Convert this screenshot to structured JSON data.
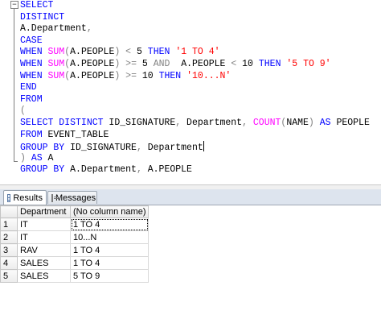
{
  "editor": {
    "lines": [
      [
        {
          "t": "SELECT",
          "c": "kw"
        }
      ],
      [
        {
          "t": "DISTINCT",
          "c": "kw"
        }
      ],
      [
        {
          "t": "A.Department",
          "c": ""
        },
        {
          "t": ",",
          "c": "op"
        }
      ],
      [
        {
          "t": "CASE",
          "c": "kw"
        }
      ],
      [
        {
          "t": "WHEN ",
          "c": "kw"
        },
        {
          "t": "SUM",
          "c": "fn"
        },
        {
          "t": "(",
          "c": "op"
        },
        {
          "t": "A.PEOPLE",
          "c": ""
        },
        {
          "t": ")",
          "c": "op"
        },
        {
          "t": " ",
          "c": ""
        },
        {
          "t": "<",
          "c": "op"
        },
        {
          "t": " 5 ",
          "c": ""
        },
        {
          "t": "THEN ",
          "c": "kw"
        },
        {
          "t": "'1 TO 4'",
          "c": "str"
        }
      ],
      [
        {
          "t": "WHEN ",
          "c": "kw"
        },
        {
          "t": "SUM",
          "c": "fn"
        },
        {
          "t": "(",
          "c": "op"
        },
        {
          "t": "A.PEOPLE",
          "c": ""
        },
        {
          "t": ")",
          "c": "op"
        },
        {
          "t": " ",
          "c": ""
        },
        {
          "t": ">=",
          "c": "op"
        },
        {
          "t": " 5 ",
          "c": ""
        },
        {
          "t": "AND",
          "c": "op"
        },
        {
          "t": "  A.PEOPLE ",
          "c": ""
        },
        {
          "t": "<",
          "c": "op"
        },
        {
          "t": " 10 ",
          "c": ""
        },
        {
          "t": "THEN ",
          "c": "kw"
        },
        {
          "t": "'5 TO 9'",
          "c": "str"
        }
      ],
      [
        {
          "t": "WHEN ",
          "c": "kw"
        },
        {
          "t": "SUM",
          "c": "fn"
        },
        {
          "t": "(",
          "c": "op"
        },
        {
          "t": "A.PEOPLE",
          "c": ""
        },
        {
          "t": ")",
          "c": "op"
        },
        {
          "t": " ",
          "c": ""
        },
        {
          "t": ">=",
          "c": "op"
        },
        {
          "t": " 10 ",
          "c": ""
        },
        {
          "t": "THEN ",
          "c": "kw"
        },
        {
          "t": "'10...N'",
          "c": "str"
        }
      ],
      [
        {
          "t": "END",
          "c": "kw"
        }
      ],
      [
        {
          "t": "FROM",
          "c": "kw"
        }
      ],
      [
        {
          "t": "(",
          "c": "op"
        }
      ],
      [
        {
          "t": "SELECT DISTINCT ",
          "c": "kw"
        },
        {
          "t": "ID_SIGNATURE",
          "c": ""
        },
        {
          "t": ",",
          "c": "op"
        },
        {
          "t": " Department",
          "c": ""
        },
        {
          "t": ",",
          "c": "op"
        },
        {
          "t": " ",
          "c": ""
        },
        {
          "t": "COUNT",
          "c": "fn"
        },
        {
          "t": "(",
          "c": "op"
        },
        {
          "t": "NAME",
          "c": ""
        },
        {
          "t": ")",
          "c": "op"
        },
        {
          "t": " ",
          "c": ""
        },
        {
          "t": "AS",
          "c": "kw"
        },
        {
          "t": " PEOPLE",
          "c": ""
        }
      ],
      [
        {
          "t": "FROM",
          "c": "kw"
        },
        {
          "t": " EVENT_TABLE",
          "c": ""
        }
      ],
      [
        {
          "t": "GROUP BY",
          "c": "kw"
        },
        {
          "t": " ID_SIGNATURE",
          "c": ""
        },
        {
          "t": ",",
          "c": "op"
        },
        {
          "t": " Department",
          "c": ""
        }
      ],
      [
        {
          "t": ")",
          "c": "op"
        },
        {
          "t": " ",
          "c": ""
        },
        {
          "t": "AS",
          "c": "kw"
        },
        {
          "t": " A",
          "c": ""
        }
      ],
      [
        {
          "t": "GROUP BY",
          "c": "kw"
        },
        {
          "t": " A.Department",
          "c": ""
        },
        {
          "t": ",",
          "c": "op"
        },
        {
          "t": " A.PEOPLE",
          "c": ""
        }
      ]
    ],
    "caret_line": 12
  },
  "tabs": {
    "results_label": "Results",
    "messages_label": "Messages"
  },
  "grid": {
    "columns": [
      "Department",
      "(No column name)"
    ],
    "rows": [
      {
        "num": "1",
        "department": "IT",
        "range": "1 TO 4"
      },
      {
        "num": "2",
        "department": "IT",
        "range": "10...N"
      },
      {
        "num": "3",
        "department": "RAV",
        "range": "1 TO 4"
      },
      {
        "num": "4",
        "department": "SALES",
        "range": "1 TO 4"
      },
      {
        "num": "5",
        "department": "SALES",
        "range": "5 TO 9"
      }
    ]
  },
  "icons": {
    "results_tab": "grid-icon",
    "messages_tab": "message-icon",
    "outline": "collapse-icon"
  },
  "colors": {
    "keyword": "#0000ff",
    "function": "#ff00ff",
    "string": "#ff0000",
    "operator": "#808080"
  }
}
